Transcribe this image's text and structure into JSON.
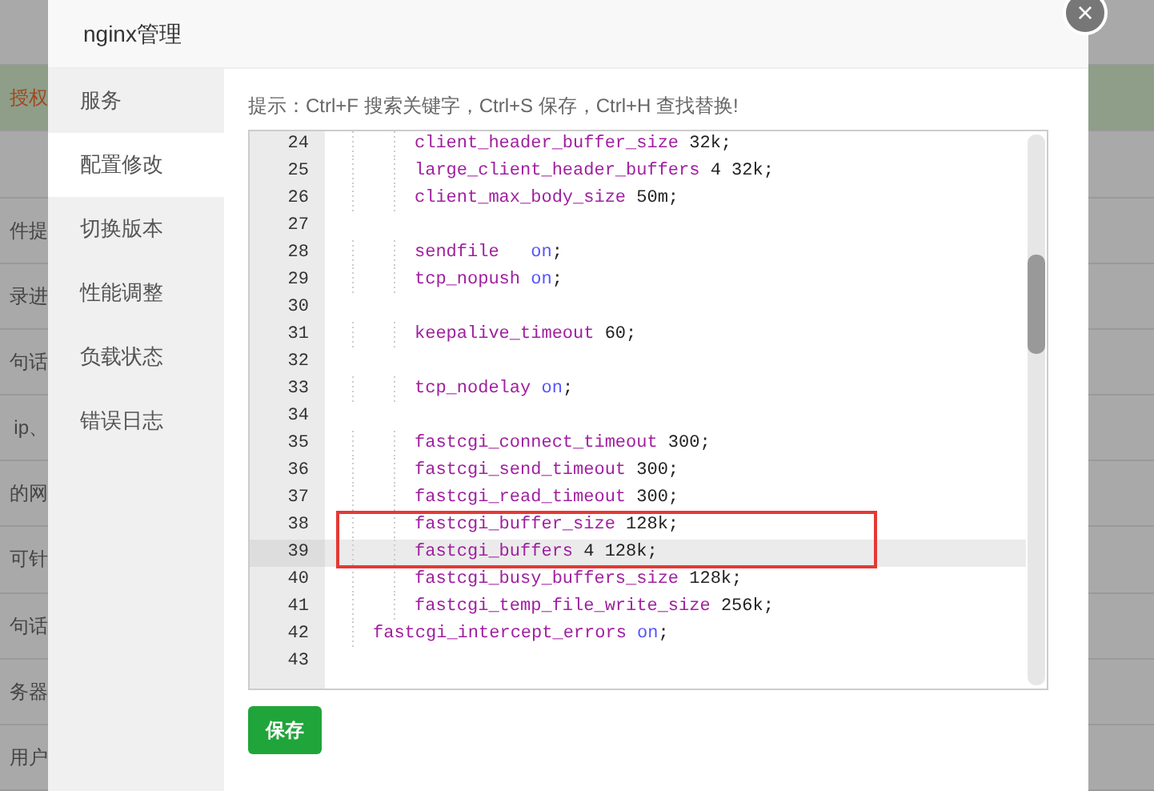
{
  "backdrop": {
    "rows": [
      {
        "selected": false
      },
      {
        "text": "授权",
        "selected": true
      },
      {
        "selected": false
      },
      {
        "text": "件提",
        "selected": false
      },
      {
        "text": "录进",
        "selected": false
      },
      {
        "text": "句话",
        "selected": false
      },
      {
        "text": "ip、",
        "selected": false
      },
      {
        "text": "的网",
        "selected": false
      },
      {
        "text": "可针",
        "selected": false
      },
      {
        "text": "句话",
        "selected": false
      },
      {
        "text": "务器",
        "selected": false
      },
      {
        "text": "用户",
        "selected": false
      }
    ]
  },
  "dialog": {
    "title": "nginx管理",
    "close": "×"
  },
  "sidebar": {
    "items": [
      {
        "label": "服务",
        "selected": false
      },
      {
        "label": "配置修改",
        "selected": true
      },
      {
        "label": "切换版本",
        "selected": false
      },
      {
        "label": "性能调整",
        "selected": false
      },
      {
        "label": "负载状态",
        "selected": false
      },
      {
        "label": "错误日志",
        "selected": false
      }
    ]
  },
  "hint": "提示：Ctrl+F 搜索关键字，Ctrl+S 保存，Ctrl+H 查找替换!",
  "editor": {
    "lines": [
      {
        "number": "24",
        "active": false,
        "boxed": false,
        "kind": "inner",
        "tokens": [
          {
            "kind": "keyword",
            "text": "client_header_buffer_size"
          },
          {
            "kind": "plain",
            "text": " 32k;"
          }
        ]
      },
      {
        "number": "25",
        "active": false,
        "boxed": false,
        "kind": "inner",
        "tokens": [
          {
            "kind": "keyword",
            "text": "large_client_header_buffers"
          },
          {
            "kind": "plain",
            "text": " 4 32k;"
          }
        ]
      },
      {
        "number": "26",
        "active": false,
        "boxed": false,
        "kind": "inner",
        "tokens": [
          {
            "kind": "keyword",
            "text": "client_max_body_size"
          },
          {
            "kind": "plain",
            "text": " 50m;"
          }
        ]
      },
      {
        "number": "27",
        "active": false,
        "boxed": false,
        "kind": "blank"
      },
      {
        "number": "28",
        "active": false,
        "boxed": false,
        "kind": "inner",
        "tokens": [
          {
            "kind": "keyword",
            "text": "sendfile"
          },
          {
            "kind": "value",
            "text": "   on"
          },
          {
            "kind": "plain",
            "text": ";"
          }
        ]
      },
      {
        "number": "29",
        "active": false,
        "boxed": false,
        "kind": "inner",
        "tokens": [
          {
            "kind": "keyword",
            "text": "tcp_nopush"
          },
          {
            "kind": "value",
            "text": " on"
          },
          {
            "kind": "plain",
            "text": ";"
          }
        ]
      },
      {
        "number": "30",
        "active": false,
        "boxed": false,
        "kind": "blank"
      },
      {
        "number": "31",
        "active": false,
        "boxed": false,
        "kind": "inner",
        "tokens": [
          {
            "kind": "keyword",
            "text": "keepalive_timeout"
          },
          {
            "kind": "plain",
            "text": " 60;"
          }
        ]
      },
      {
        "number": "32",
        "active": false,
        "boxed": false,
        "kind": "blank"
      },
      {
        "number": "33",
        "active": false,
        "boxed": false,
        "kind": "inner",
        "tokens": [
          {
            "kind": "keyword",
            "text": "tcp_nodelay"
          },
          {
            "kind": "value",
            "text": " on"
          },
          {
            "kind": "plain",
            "text": ";"
          }
        ]
      },
      {
        "number": "34",
        "active": false,
        "boxed": false,
        "kind": "blank"
      },
      {
        "number": "35",
        "active": false,
        "boxed": false,
        "kind": "inner",
        "tokens": [
          {
            "kind": "keyword",
            "text": "fastcgi_connect_timeout"
          },
          {
            "kind": "plain",
            "text": " 300;"
          }
        ]
      },
      {
        "number": "36",
        "active": false,
        "boxed": false,
        "kind": "inner",
        "tokens": [
          {
            "kind": "keyword",
            "text": "fastcgi_send_timeout"
          },
          {
            "kind": "plain",
            "text": " 300;"
          }
        ]
      },
      {
        "number": "37",
        "active": false,
        "boxed": false,
        "kind": "inner",
        "tokens": [
          {
            "kind": "keyword",
            "text": "fastcgi_read_timeout"
          },
          {
            "kind": "plain",
            "text": " 300;"
          }
        ]
      },
      {
        "number": "38",
        "active": false,
        "boxed": true,
        "kind": "inner",
        "tokens": [
          {
            "kind": "keyword",
            "text": "fastcgi_buffer_size"
          },
          {
            "kind": "plain",
            "text": " 128k;"
          }
        ]
      },
      {
        "number": "39",
        "active": true,
        "boxed": true,
        "kind": "inner",
        "tokens": [
          {
            "kind": "keyword",
            "text": "fastcgi_buffers"
          },
          {
            "kind": "plain",
            "text": " 4 128k;"
          }
        ]
      },
      {
        "number": "40",
        "active": false,
        "boxed": false,
        "kind": "inner",
        "tokens": [
          {
            "kind": "keyword",
            "text": "fastcgi_busy_buffers_size"
          },
          {
            "kind": "plain",
            "text": " 128k;"
          }
        ]
      },
      {
        "number": "41",
        "active": false,
        "boxed": false,
        "kind": "inner",
        "tokens": [
          {
            "kind": "keyword",
            "text": "fastcgi_temp_file_write_size"
          },
          {
            "kind": "plain",
            "text": " 256k;"
          }
        ]
      },
      {
        "number": "42",
        "active": false,
        "boxed": false,
        "kind": "outer",
        "tokens": [
          {
            "kind": "keyword",
            "text": "fastcgi_intercept_errors"
          },
          {
            "kind": "value",
            "text": " on"
          },
          {
            "kind": "plain",
            "text": ";"
          }
        ]
      },
      {
        "number": "43",
        "active": false,
        "boxed": false,
        "kind": "blank"
      }
    ]
  },
  "save_button": "保存"
}
